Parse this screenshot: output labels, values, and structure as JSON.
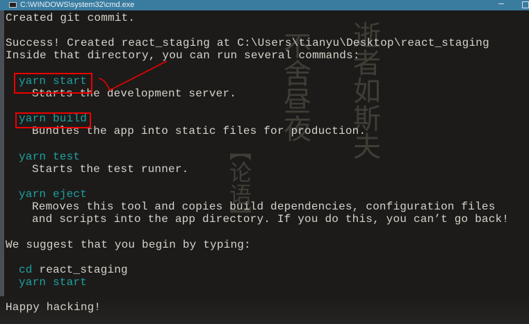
{
  "window": {
    "title": "C:\\WINDOWS\\system32\\cmd.exe"
  },
  "console": {
    "lines": {
      "l0": "Created git commit.",
      "l2": "Success! Created react_staging at C:\\Users\\tianyu\\Desktop\\react_staging",
      "l3": "Inside that directory, you can run several commands:",
      "l5": "yarn start",
      "l6": "Starts the development server.",
      "l8": "yarn build",
      "l9": "Bundles the app into static files for production.",
      "l11": "yarn test",
      "l12": "Starts the test runner.",
      "l14": "yarn eject",
      "l15": "Removes this tool and copies build dependencies, configuration files",
      "l16": "and scripts into the app directory. If you do this, you can’t go back!",
      "l18": "We suggest that you begin by typing:",
      "l20a": "cd",
      "l20b": "react_staging",
      "l21": "yarn start",
      "l23": "Happy hacking!"
    }
  },
  "colors": {
    "titlebar": "#3a7ca0",
    "command": "#1aa3a3",
    "annotation": "#e00000"
  }
}
